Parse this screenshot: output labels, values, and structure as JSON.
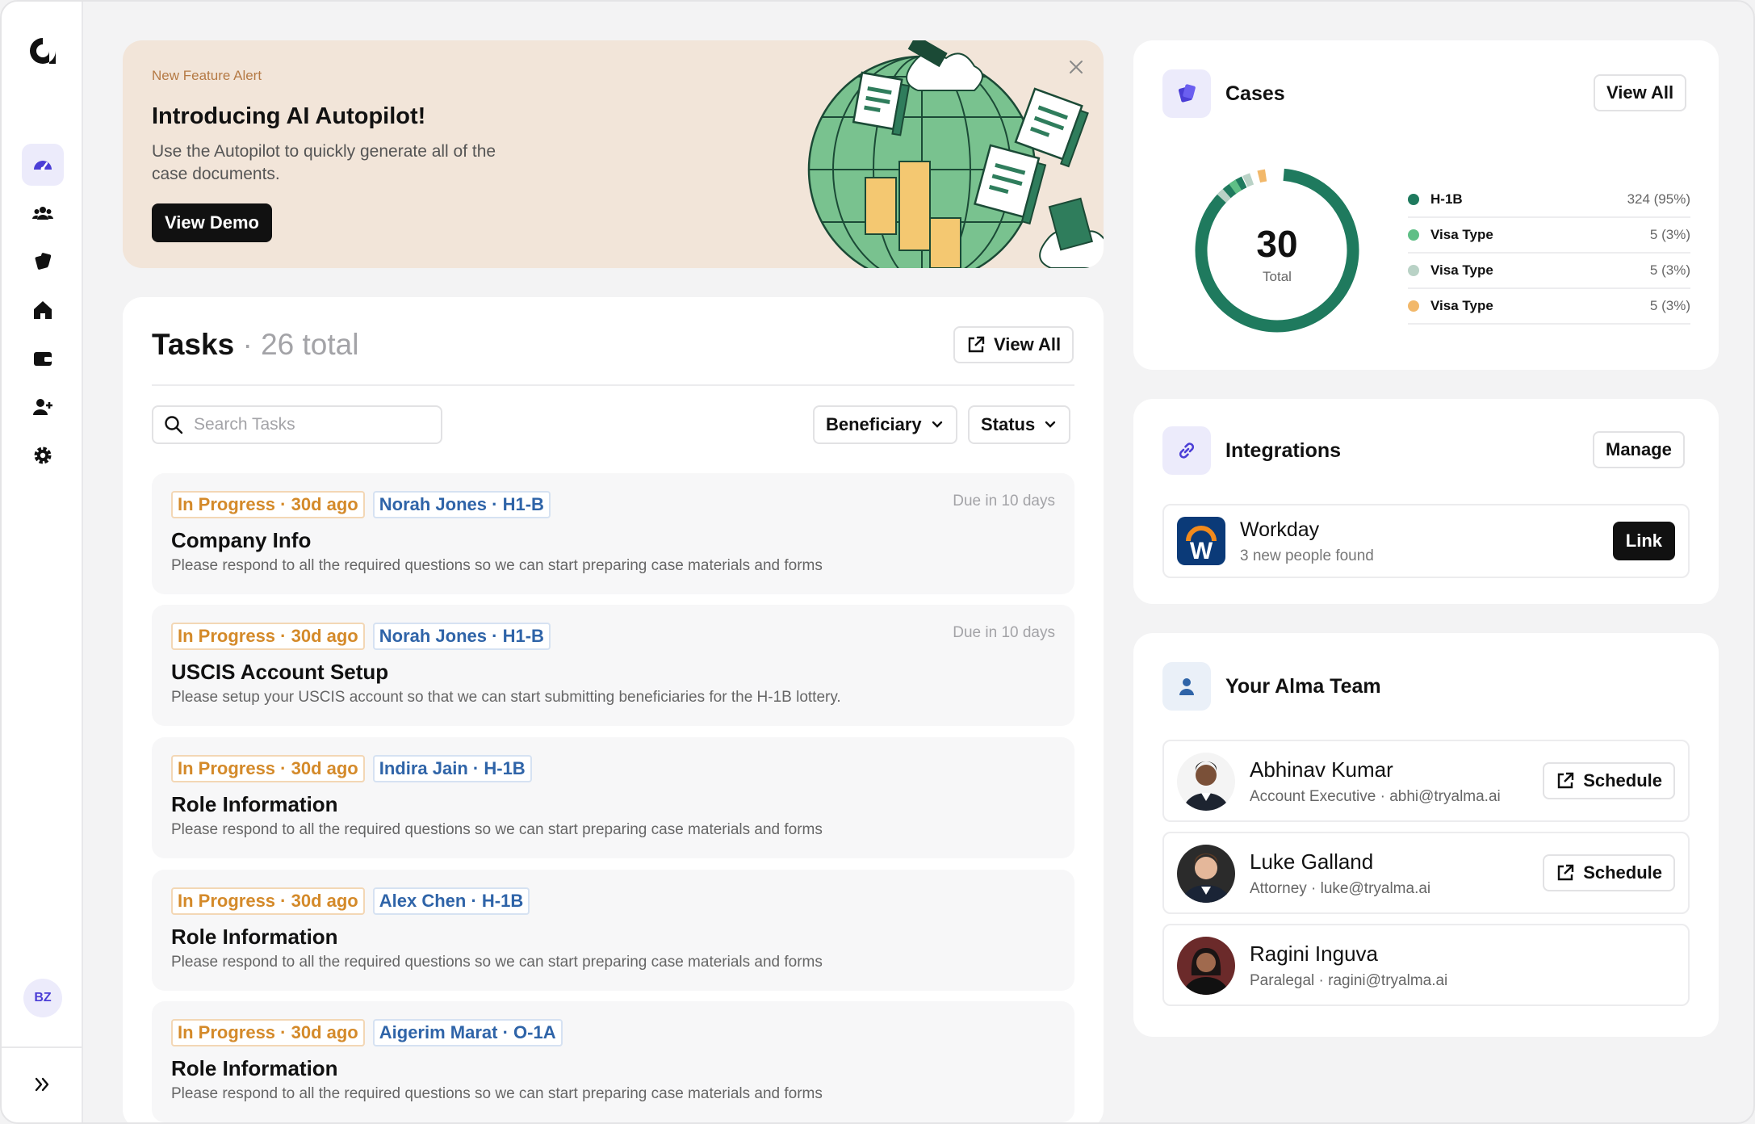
{
  "sidebar": {
    "logo": "alma-logo",
    "items": [
      {
        "name": "dashboard",
        "icon": "dashboard-icon",
        "active": true
      },
      {
        "name": "people",
        "icon": "users-icon",
        "active": false
      },
      {
        "name": "cases",
        "icon": "cases-icon",
        "active": false
      },
      {
        "name": "home",
        "icon": "home-icon",
        "active": false
      },
      {
        "name": "wallet",
        "icon": "wallet-icon",
        "active": false
      },
      {
        "name": "add-user",
        "icon": "add-user-icon",
        "active": false
      },
      {
        "name": "settings",
        "icon": "gear-icon",
        "active": false
      }
    ],
    "user_initials": "BZ",
    "expand_icon": "chevrons-right-icon"
  },
  "banner": {
    "kicker": "New Feature Alert",
    "title": "Introducing AI Autopilot!",
    "description": "Use the Autopilot to quickly generate all of the case documents.",
    "button_label": "View Demo",
    "close_icon": "close-icon"
  },
  "tasks": {
    "title": "Tasks",
    "count_label": "26 total",
    "view_all_label": "View All",
    "search_placeholder": "Search Tasks",
    "filters": [
      "Beneficiary",
      "Status"
    ],
    "items": [
      {
        "status": "In Progress",
        "age": "30d ago",
        "person": "Norah Jones",
        "visa": "H1-B",
        "due": "Due in 10 days",
        "title": "Company Info",
        "description": "Please respond to all the required questions so we can start preparing case materials and forms"
      },
      {
        "status": "In Progress",
        "age": "30d ago",
        "person": "Norah Jones",
        "visa": "H1-B",
        "due": "Due in 10 days",
        "title": "USCIS Account Setup",
        "description": "Please setup your USCIS account so that we can start submitting beneficiaries for the H-1B lottery."
      },
      {
        "status": "In Progress",
        "age": "30d ago",
        "person": "Indira Jain",
        "visa": "H-1B",
        "due": "",
        "title": "Role Information",
        "description": "Please respond to all the required questions so we can start preparing case materials and forms"
      },
      {
        "status": "In Progress",
        "age": "30d ago",
        "person": "Alex Chen",
        "visa": "H-1B",
        "due": "",
        "title": "Role Information",
        "description": "Please respond to all the required questions so we can start preparing case materials and forms"
      },
      {
        "status": "In Progress",
        "age": "30d ago",
        "person": "Aigerim Marat",
        "visa": "O-1A",
        "due": "",
        "title": "Role Information",
        "description": "Please respond to all the required questions so we can start preparing case materials and forms"
      }
    ]
  },
  "cases": {
    "title": "Cases",
    "view_all_label": "View All",
    "total": "30",
    "total_label": "Total",
    "legend": [
      {
        "label": "H-1B",
        "value": "324 (95%)",
        "color": "#1f7a5e"
      },
      {
        "label": "Visa Type",
        "value": "5 (3%)",
        "color": "#5fbf86"
      },
      {
        "label": "Visa Type",
        "value": "5 (3%)",
        "color": "#b9d2c6"
      },
      {
        "label": "Visa Type",
        "value": "5 (3%)",
        "color": "#f2b86a"
      }
    ]
  },
  "integrations": {
    "title": "Integrations",
    "manage_label": "Manage",
    "items": [
      {
        "name": "Workday",
        "subtitle": "3 new people found",
        "action": "Link",
        "logo_letter": "W"
      }
    ]
  },
  "team": {
    "title": "Your Alma Team",
    "members": [
      {
        "name": "Abhinav Kumar",
        "subtitle": "Account Executive · abhi@tryalma.ai",
        "action": "Schedule"
      },
      {
        "name": "Luke Galland",
        "subtitle": "Attorney · luke@tryalma.ai",
        "action": "Schedule"
      },
      {
        "name": "Ragini Inguva",
        "subtitle": "Paralegal · ragini@tryalma.ai",
        "action": ""
      }
    ]
  },
  "colors": {
    "accent": "#4b3ed6",
    "chart_green": "#1f7a5e",
    "banner_bg": "#f2e5d9",
    "status_orange": "#d48a2a",
    "person_blue": "#2f64a8"
  }
}
